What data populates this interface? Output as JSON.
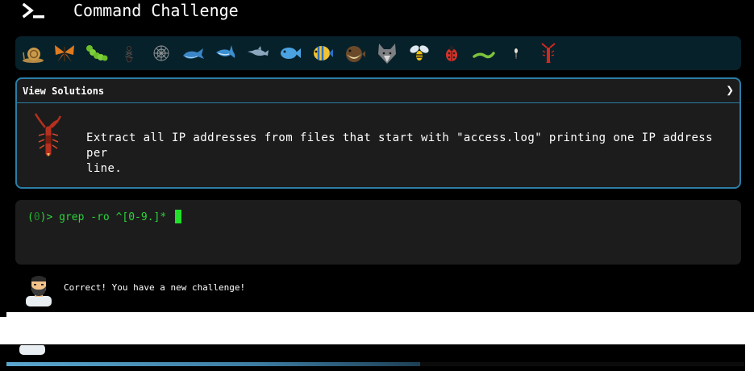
{
  "header": {
    "title": "Command Challenge",
    "logo_icon": "terminal-prompt-icon"
  },
  "icon_strip": {
    "icons": [
      "snail-icon",
      "butterfly-icon",
      "caterpillar-icon",
      "ant-icon",
      "spider-web-icon",
      "whale-icon",
      "shark-icon",
      "dolphin-icon",
      "fish-icon",
      "tropical-fish-icon",
      "pufferfish-icon",
      "wolf-icon",
      "bee-icon",
      "ladybug-icon",
      "worm-icon",
      "bug-icon",
      "lobster-icon"
    ]
  },
  "challenge": {
    "solutions_label": "View Solutions",
    "chevron": "❯",
    "mascot_icon": "scorpion-icon",
    "text_line1": "Extract all IP addresses from files that start with \"access.log\" printing one IP address per",
    "text_line2": "line."
  },
  "terminal": {
    "prompt_open": "(",
    "prompt_num": "0",
    "prompt_close": ")> ",
    "command": "grep -ro ^[0-9.]* "
  },
  "message": {
    "text": "Correct! You have a new challenge!",
    "avatar_icon": "bearded-man-avatar"
  },
  "progress": {
    "fraction": 0.56
  },
  "colors": {
    "background": "#000000",
    "strip": "#07212b",
    "panel": "#1c1c1c",
    "accent_border": "#2a7ea6",
    "terminal_green": "#2bd43a",
    "cursor": "#22e02a"
  }
}
